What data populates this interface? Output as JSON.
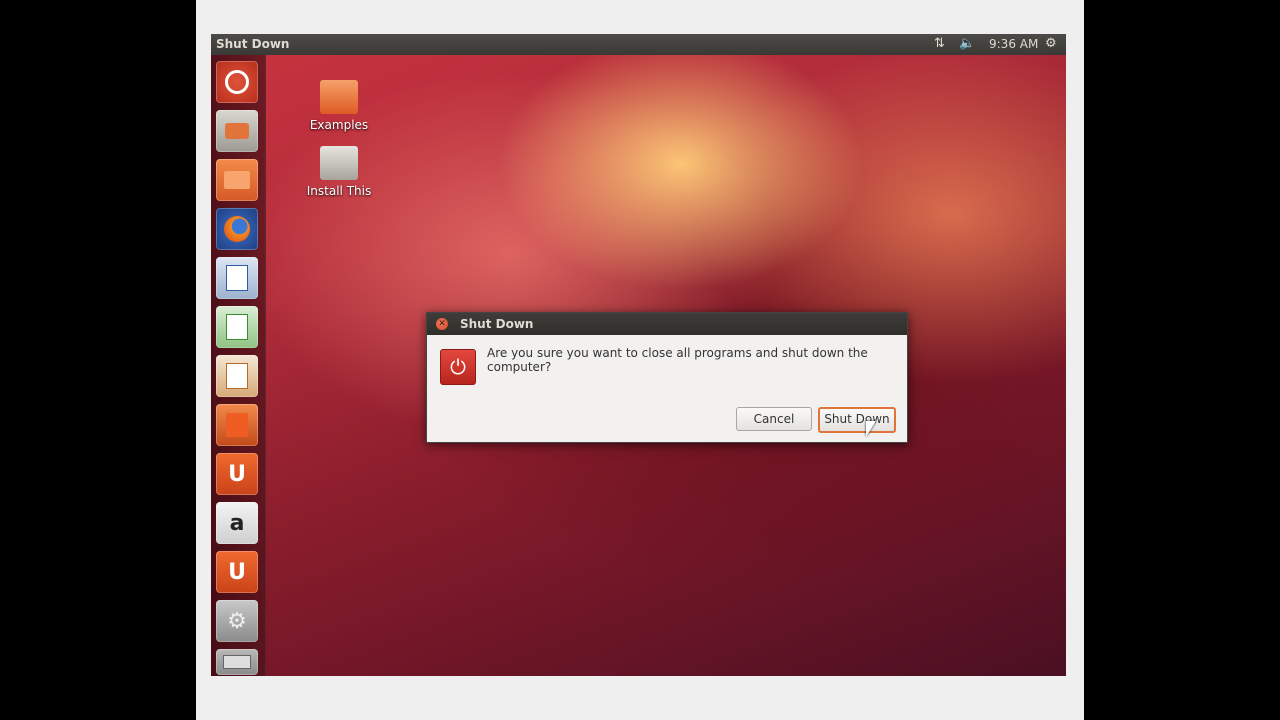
{
  "topbar": {
    "title": "Shut Down",
    "network_icon": "network-arrows-icon",
    "volume_icon": "speaker-icon",
    "clock": "9:36 AM",
    "session_icon": "gear-icon"
  },
  "launcher": {
    "items": [
      {
        "name": "dash-home",
        "icon": "ubuntu-logo-icon"
      },
      {
        "name": "install-ubuntu",
        "icon": "installer-icon"
      },
      {
        "name": "home-folder",
        "icon": "folder-icon"
      },
      {
        "name": "firefox",
        "icon": "firefox-icon"
      },
      {
        "name": "libreoffice-writer",
        "icon": "writer-icon"
      },
      {
        "name": "libreoffice-calc",
        "icon": "calc-icon"
      },
      {
        "name": "libreoffice-impress",
        "icon": "impress-icon"
      },
      {
        "name": "software-center",
        "icon": "shopping-bag-icon"
      },
      {
        "name": "ubuntu-one",
        "icon": "ubuntu-one-icon",
        "glyph": "U"
      },
      {
        "name": "amazon",
        "icon": "amazon-icon",
        "glyph": "a"
      },
      {
        "name": "ubuntu-one-music",
        "icon": "ubuntu-one-music-icon",
        "glyph": "U"
      },
      {
        "name": "system-settings",
        "icon": "settings-wrench-icon"
      },
      {
        "name": "removable-drive",
        "icon": "drive-icon"
      }
    ]
  },
  "desktop": {
    "icons": [
      {
        "label": "Examples",
        "icon": "folder-link-icon"
      },
      {
        "label": "Install This",
        "icon": "installer-icon"
      }
    ]
  },
  "dialog": {
    "title": "Shut Down",
    "message": "Are you sure you want to close all programs and shut down the computer?",
    "icon": "power-icon",
    "cancel_label": "Cancel",
    "confirm_label": "Shut Down"
  },
  "colors": {
    "accent": "#e0743b",
    "power_red": "#d0342a"
  }
}
